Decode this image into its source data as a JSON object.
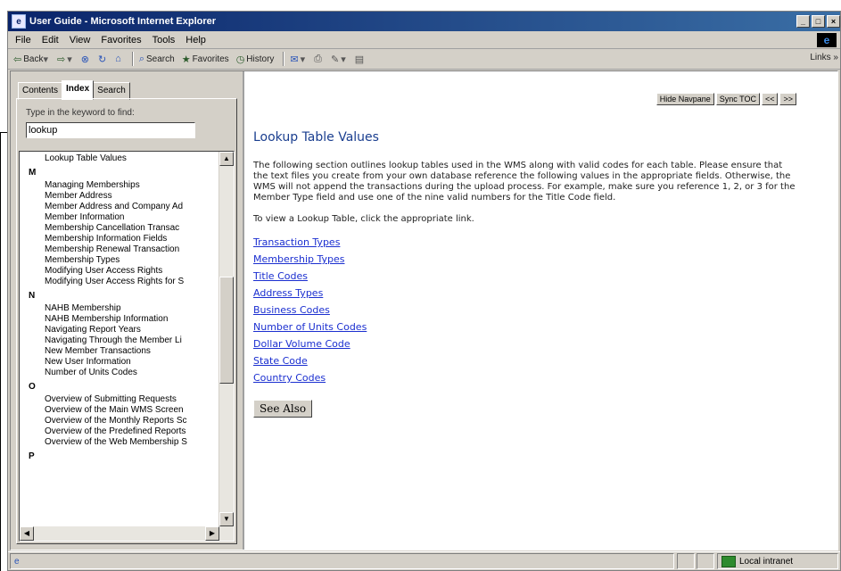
{
  "window": {
    "title": "User Guide - Microsoft Internet Explorer",
    "controls": [
      "_",
      "□",
      "×"
    ]
  },
  "menubar": {
    "items": [
      "File",
      "Edit",
      "View",
      "Favorites",
      "Tools",
      "Help"
    ]
  },
  "toolbar": {
    "back_label": "Back",
    "search_label": "Search",
    "favorites_label": "Favorites",
    "history_label": "History",
    "links_label": "Links »"
  },
  "nav_pane": {
    "tabs": [
      "Contents",
      "Index",
      "Search"
    ],
    "active_tab": "Index",
    "keyword_label": "Type in the keyword to find:",
    "keyword_value": "lookup",
    "index_entries": [
      {
        "type": "item",
        "text": "Lookup Table Values"
      },
      {
        "type": "letter",
        "text": "M"
      },
      {
        "type": "item",
        "text": "Managing Memberships"
      },
      {
        "type": "item",
        "text": "Member Address"
      },
      {
        "type": "item",
        "text": "Member Address and Company Ad"
      },
      {
        "type": "item",
        "text": "Member Information"
      },
      {
        "type": "item",
        "text": "Membership Cancellation Transac"
      },
      {
        "type": "item",
        "text": "Membership Information Fields"
      },
      {
        "type": "item",
        "text": "Membership Renewal Transaction"
      },
      {
        "type": "item",
        "text": "Membership Types"
      },
      {
        "type": "item",
        "text": "Modifying User Access Rights"
      },
      {
        "type": "item",
        "text": "Modifying User Access Rights for S"
      },
      {
        "type": "letter",
        "text": "N"
      },
      {
        "type": "item",
        "text": "NAHB Membership"
      },
      {
        "type": "item",
        "text": "NAHB Membership Information"
      },
      {
        "type": "item",
        "text": "Navigating Report Years"
      },
      {
        "type": "item",
        "text": "Navigating Through the Member Li"
      },
      {
        "type": "item",
        "text": "New Member Transactions"
      },
      {
        "type": "item",
        "text": "New User Information"
      },
      {
        "type": "item",
        "text": "Number of Units Codes"
      },
      {
        "type": "letter",
        "text": "O"
      },
      {
        "type": "item",
        "text": "Overview of Submitting Requests"
      },
      {
        "type": "item",
        "text": "Overview of the Main WMS Screen"
      },
      {
        "type": "item",
        "text": "Overview of the Monthly Reports Sc"
      },
      {
        "type": "item",
        "text": "Overview of the Predefined Reports"
      },
      {
        "type": "item",
        "text": "Overview of the Web Membership S"
      },
      {
        "type": "letter",
        "text": "P"
      }
    ]
  },
  "main": {
    "nav_buttons": [
      "Hide Navpane",
      "Sync TOC",
      "<<",
      ">>"
    ],
    "heading": "Lookup Table Values",
    "intro": "The following section outlines lookup tables used in the WMS along with valid codes for each table.  Please ensure that the text files you create from your own database reference the following values in the appropriate fields.  Otherwise, the WMS will not append the transactions during the upload process.  For example, make sure you reference 1, 2, or 3 for the Member Type field and use one of the nine valid numbers for the Title Code field.",
    "view_text": "To view a Lookup Table, click the appropriate link.",
    "links": [
      "Transaction Types",
      "Membership Types",
      "Title Codes",
      "Address Types",
      "Business Codes",
      "Number of Units Codes",
      "Dollar Volume Code",
      "State Code",
      "Country Codes"
    ],
    "see_also_label": "See Also"
  },
  "statusbar": {
    "zone_label": "Local intranet"
  }
}
